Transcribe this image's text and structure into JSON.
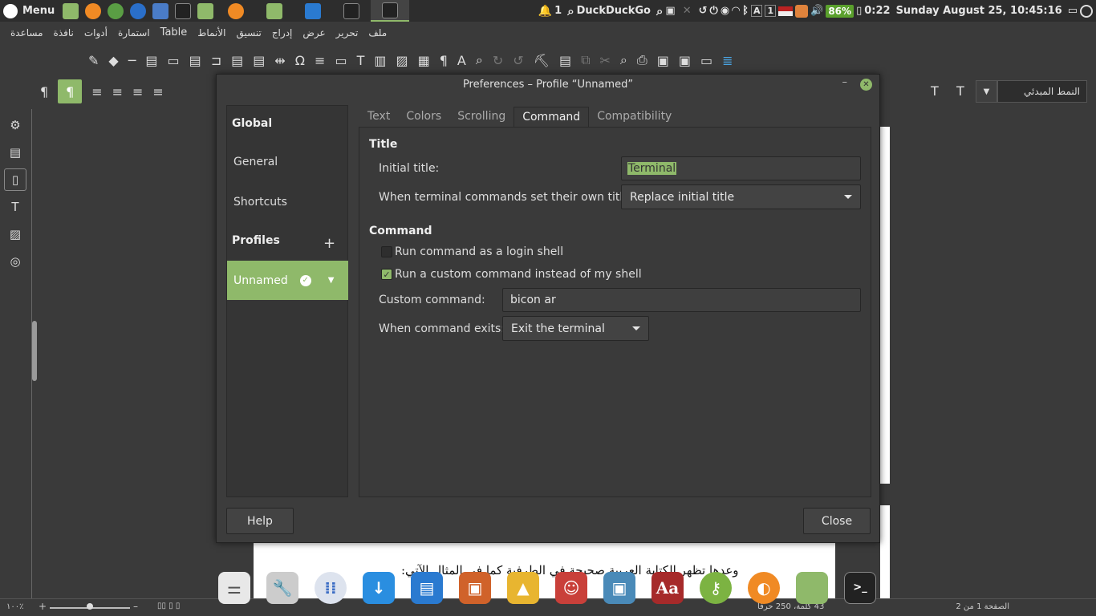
{
  "top_panel": {
    "menu_label": "Menu",
    "notification_count": "1",
    "search_label": "DuckDuckGo",
    "battery": "86%",
    "battery_time": "0:22",
    "datetime": "Sunday August 25, 10:45:16"
  },
  "libreoffice": {
    "menu": [
      "ملف",
      "تحرير",
      "عرض",
      "إدراج",
      "تنسيق",
      "الأنماط",
      "Table",
      "استمارة",
      "أدوات",
      "نافذة",
      "مساعدة"
    ],
    "paragraph_style": "النمط المبدئي",
    "document_text": "وعدها تظهر الكتابة العربية صحيحة في الطرفية كما في المثال الآتي:",
    "zoom": "١٠٠٪",
    "status_page": "الصفحة 1 من 2",
    "status_words": "43 كلمة، 250 حرفًا"
  },
  "dialog": {
    "title": "Preferences – Profile “Unnamed”",
    "sidebar": {
      "global_heading": "Global",
      "general": "General",
      "shortcuts": "Shortcuts",
      "profiles_heading": "Profiles",
      "selected_profile": "Unnamed"
    },
    "tabs": [
      "Text",
      "Colors",
      "Scrolling",
      "Command",
      "Compatibility"
    ],
    "title_section": {
      "heading": "Title",
      "initial_title_label": "Initial title:",
      "initial_title_value": "Terminal",
      "set_titles_label": "When terminal commands set their own titles:",
      "set_titles_value": "Replace initial title"
    },
    "command_section": {
      "heading": "Command",
      "login_shell_label": "Run command as a login shell",
      "login_shell_checked": false,
      "custom_command_toggle_label": "Run a custom command instead of my shell",
      "custom_command_toggle_checked": true,
      "custom_command_label": "Custom command:",
      "custom_command_value": "bicon ar",
      "on_exit_label": "When command exits:",
      "on_exit_value": "Exit the terminal"
    },
    "help_button": "Help",
    "close_button": "Close"
  },
  "colors": {
    "accent": "#8fb96a",
    "panel_bg": "#2d2d2d",
    "dialog_bg": "#3c3c3c"
  }
}
